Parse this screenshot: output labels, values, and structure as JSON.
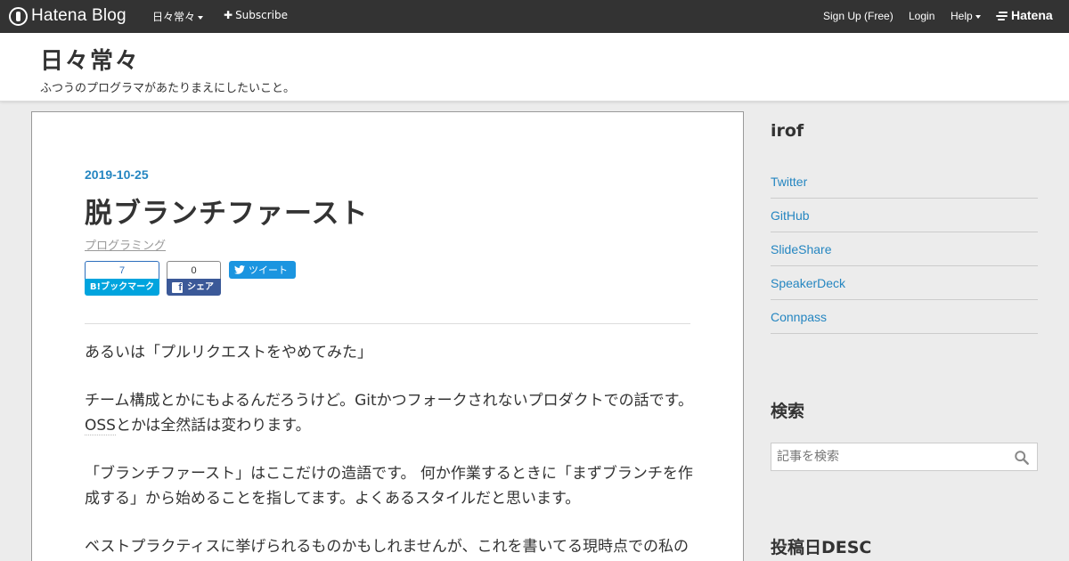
{
  "topbar": {
    "logo_text": "Hatena Blog",
    "blog_menu": "日々常々",
    "subscribe": "Subscribe",
    "signup": "Sign Up (Free)",
    "login": "Login",
    "help": "Help",
    "hatena": "Hatena"
  },
  "header": {
    "title": "日々常々",
    "description": "ふつうのプログラマがあたりまえにしたいこと。"
  },
  "entry": {
    "date": "2019-10-25",
    "title": "脱ブランチファースト",
    "category": "プログラミング",
    "bookmark_count": "7",
    "bookmark_label": "B!ブックマーク",
    "share_count": "0",
    "share_label": "シェア",
    "tweet_label": "ツイート",
    "paragraphs": [
      {
        "before": "あるいは「プルリクエストをやめてみた」",
        "kw": "",
        "after": ""
      },
      {
        "before": "チーム構成とかにもよるんだろうけど。Gitかつフォークされないプロダクトでの話です。",
        "kw": "OSS",
        "after": "とかは全然話は変わります。"
      },
      {
        "before": "「ブランチファースト」はここだけの造語です。 何か作業するときに「まずブランチを作成する」から始めることを指してます。よくあるスタイルだと思います。",
        "kw": "",
        "after": ""
      },
      {
        "before": "ベストプラクティスに挙げられるものかもしれませんが、これを書いてる現時点での私の",
        "kw": "",
        "after": ""
      }
    ]
  },
  "sidebar": {
    "profile_name": "irof",
    "links": [
      "Twitter",
      "GitHub",
      "SlideShare",
      "SpeakerDeck",
      "Connpass"
    ],
    "search_title": "検索",
    "search_placeholder": "記事を検索",
    "archive_title": "投稿日DESC"
  },
  "colors": {
    "topbar": "#333333",
    "accent": "#2586c1",
    "bookmark": "#00a4de",
    "facebook": "#3b5998",
    "twitter": "#1b95e0"
  },
  "icons": [
    "hatena-blog-logo-icon",
    "plus-icon",
    "hatena-logo-icon",
    "facebook-icon",
    "twitter-bird-icon",
    "search-icon"
  ]
}
